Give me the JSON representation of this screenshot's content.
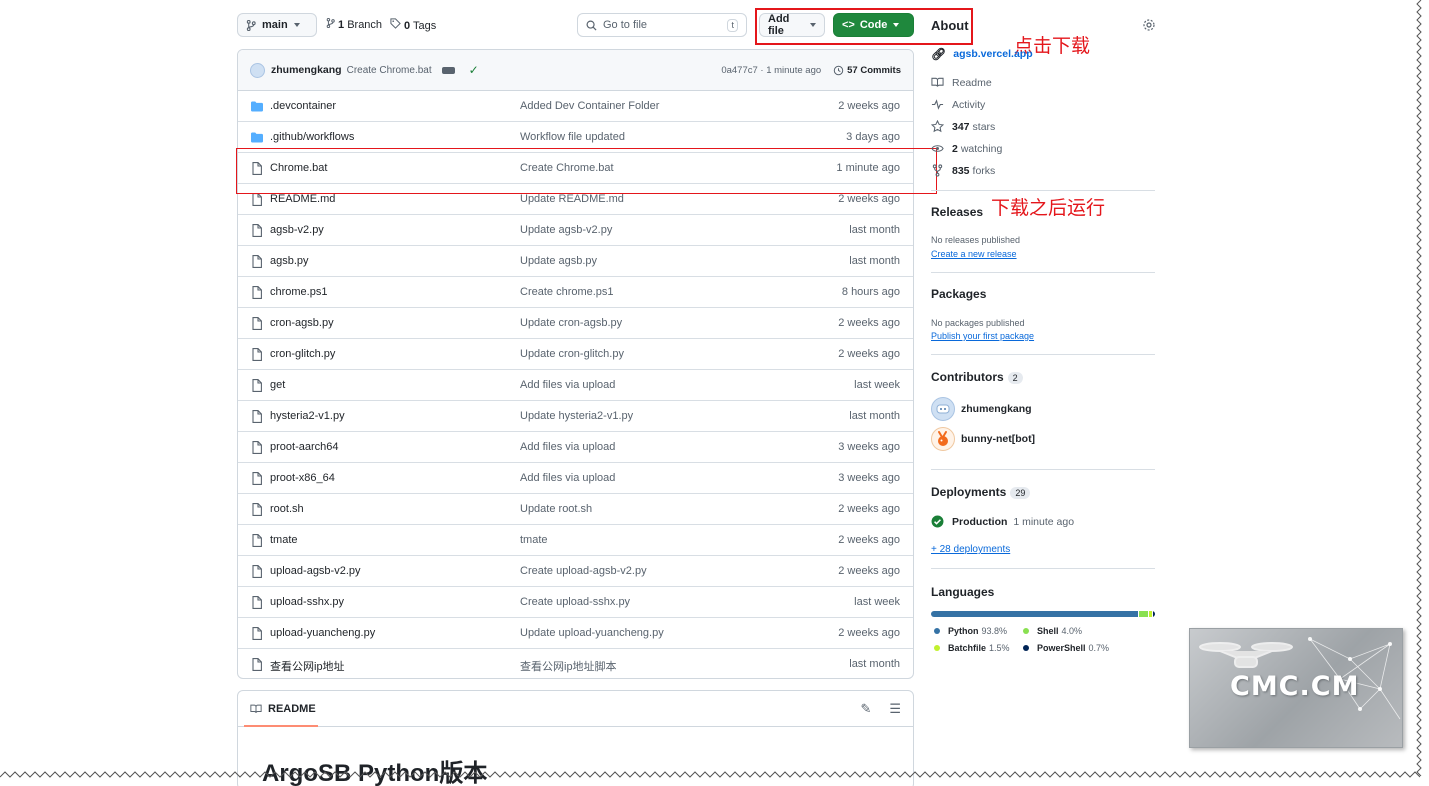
{
  "topbar": {
    "branch_label": "main",
    "branch_count": "1",
    "branch_word": "Branch",
    "tag_count": "0",
    "tag_word": "Tags",
    "goto_placeholder": "Go to file",
    "goto_kbd": "t",
    "addfile_label": "Add file",
    "code_label": "Code"
  },
  "annotations": {
    "click_download": "点击下载",
    "run_after_download": "下载之后运行"
  },
  "commit": {
    "user": "zhumengkang",
    "message": "Create Chrome.bat",
    "hash_time": "0a477c7 · 1 minute ago",
    "commits": "57 Commits"
  },
  "files": [
    {
      "name": ".devcontainer",
      "type": "folder",
      "message": "Added Dev Container Folder",
      "date": "2 weeks ago"
    },
    {
      "name": ".github/workflows",
      "type": "folder",
      "message": "Workflow file updated",
      "date": "3 days ago"
    },
    {
      "name": "Chrome.bat",
      "type": "file",
      "message": "Create Chrome.bat",
      "date": "1 minute ago"
    },
    {
      "name": "README.md",
      "type": "file",
      "message": "Update README.md",
      "date": "2 weeks ago"
    },
    {
      "name": "agsb-v2.py",
      "type": "file",
      "message": "Update agsb-v2.py",
      "date": "last month"
    },
    {
      "name": "agsb.py",
      "type": "file",
      "message": "Update agsb.py",
      "date": "last month"
    },
    {
      "name": "chrome.ps1",
      "type": "file",
      "message": "Create chrome.ps1",
      "date": "8 hours ago"
    },
    {
      "name": "cron-agsb.py",
      "type": "file",
      "message": "Update cron-agsb.py",
      "date": "2 weeks ago"
    },
    {
      "name": "cron-glitch.py",
      "type": "file",
      "message": "Update cron-glitch.py",
      "date": "2 weeks ago"
    },
    {
      "name": "get",
      "type": "file",
      "message": "Add files via upload",
      "date": "last week"
    },
    {
      "name": "hysteria2-v1.py",
      "type": "file",
      "message": "Update hysteria2-v1.py",
      "date": "last month"
    },
    {
      "name": "proot-aarch64",
      "type": "file",
      "message": "Add files via upload",
      "date": "3 weeks ago"
    },
    {
      "name": "proot-x86_64",
      "type": "file",
      "message": "Add files via upload",
      "date": "3 weeks ago"
    },
    {
      "name": "root.sh",
      "type": "file",
      "message": "Update root.sh",
      "date": "2 weeks ago"
    },
    {
      "name": "tmate",
      "type": "file",
      "message": "tmate",
      "date": "2 weeks ago"
    },
    {
      "name": "upload-agsb-v2.py",
      "type": "file",
      "message": "Create upload-agsb-v2.py",
      "date": "2 weeks ago"
    },
    {
      "name": "upload-sshx.py",
      "type": "file",
      "message": "Create upload-sshx.py",
      "date": "last week"
    },
    {
      "name": "upload-yuancheng.py",
      "type": "file",
      "message": "Update upload-yuancheng.py",
      "date": "2 weeks ago"
    },
    {
      "name": "查看公网ip地址",
      "type": "file",
      "message": "查看公网ip地址脚本",
      "date": "last month"
    }
  ],
  "readme": {
    "tab_label": "README",
    "title": "ArgoSB Python版本"
  },
  "about": {
    "title": "About",
    "website": "agsb.vercel.app",
    "readme": "Readme",
    "activity": "Activity",
    "stars_count": "347",
    "stars_word": "stars",
    "watching_count": "2",
    "watching_word": "watching",
    "forks_count": "835",
    "forks_word": "forks"
  },
  "releases": {
    "title": "Releases",
    "note": "No releases published",
    "link": "Create a new release"
  },
  "packages": {
    "title": "Packages",
    "note": "No packages published",
    "link": "Publish your first package"
  },
  "contributors": {
    "title": "Contributors",
    "count": "2",
    "people": [
      "zhumengkang",
      "bunny-net[bot]"
    ]
  },
  "deployments": {
    "title": "Deployments",
    "count": "29",
    "env": "Production",
    "time": "1 minute ago",
    "more": "+ 28 deployments"
  },
  "languages": {
    "title": "Languages",
    "items": [
      {
        "name": "Python",
        "percent": "93.8%",
        "value": 93.8,
        "color": "#3572A5"
      },
      {
        "name": "Shell",
        "percent": "4.0%",
        "value": 4.0,
        "color": "#89e051"
      },
      {
        "name": "Batchfile",
        "percent": "1.5%",
        "value": 1.5,
        "color": "#C1F12E"
      },
      {
        "name": "PowerShell",
        "percent": "0.7%",
        "value": 0.7,
        "color": "#012456"
      }
    ]
  },
  "watermark": {
    "text": "CMC.CM"
  }
}
